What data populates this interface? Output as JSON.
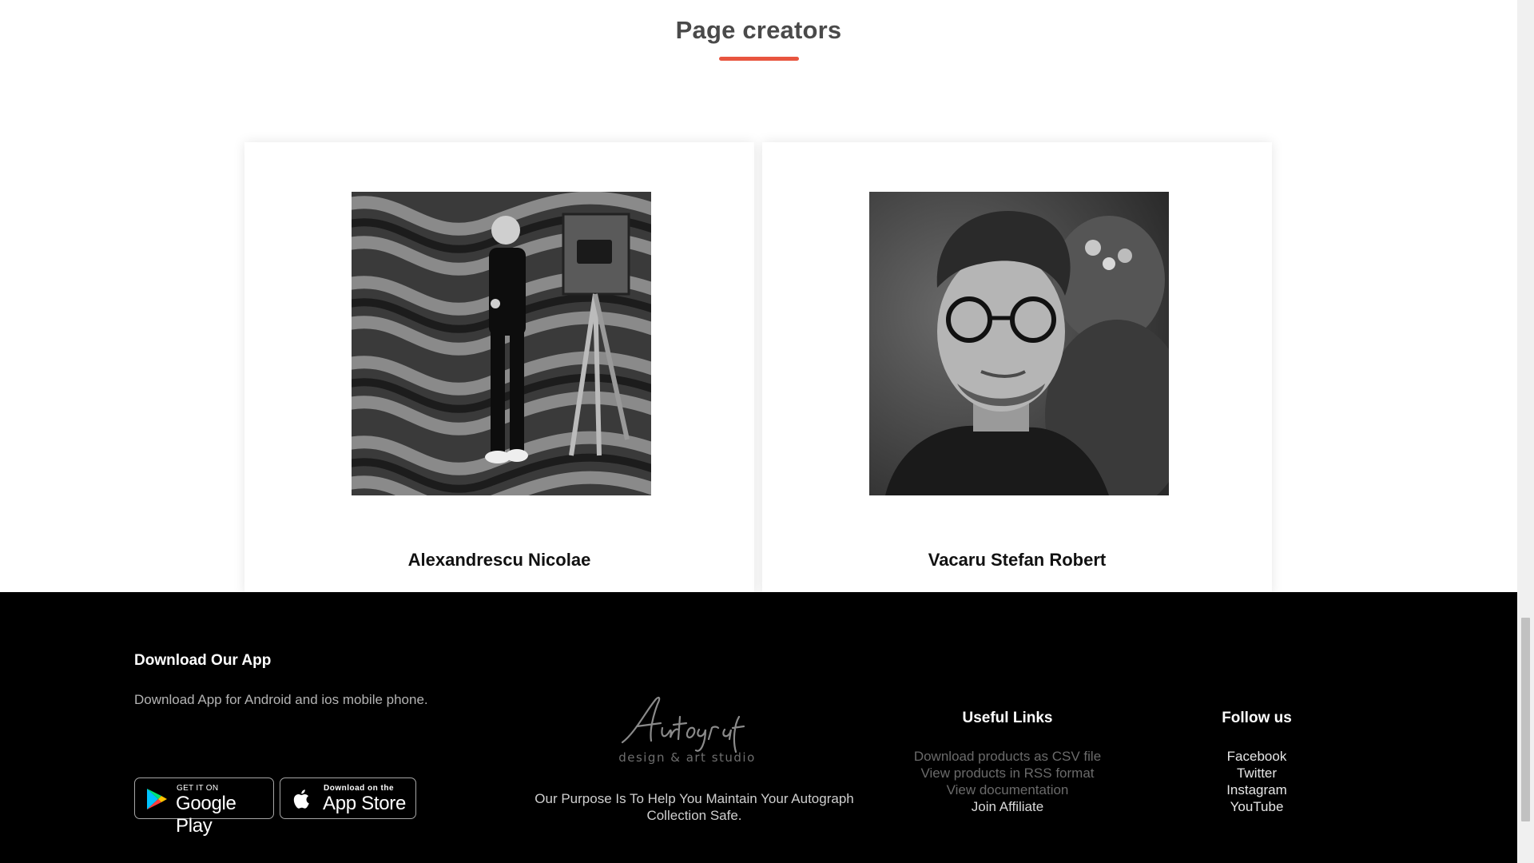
{
  "section": {
    "title": "Page creators",
    "accent_color": "#e8553f"
  },
  "creators": [
    {
      "name": "Alexandrescu Nicolae"
    },
    {
      "name": "Vacaru Stefan Robert"
    }
  ],
  "footer": {
    "app": {
      "title": "Download Our App",
      "description": "Download App for Android and ios mobile phone.",
      "google_badge": {
        "small": "GET IT ON",
        "big": "Google Play",
        "icon": "google-play-icon"
      },
      "apple_badge": {
        "small": "Download on the",
        "big": "App Store",
        "icon": "apple-icon"
      }
    },
    "logo": {
      "script_text": "Autograf",
      "subtitle": "design & art studio"
    },
    "purpose": "Our Purpose Is To Help You Maintain Your Autograph Collection Safe.",
    "useful_links": {
      "title": "Useful Links",
      "items": [
        "Download products as CSV file",
        "View products in RSS format",
        "View documentation",
        "Join Affiliate"
      ]
    },
    "follow_us": {
      "title": "Follow us",
      "items": [
        "Facebook",
        "Twitter",
        "Instagram",
        "YouTube"
      ]
    }
  },
  "colors": {
    "footer_bg": "#000000",
    "page_bg": "#ffffff"
  }
}
